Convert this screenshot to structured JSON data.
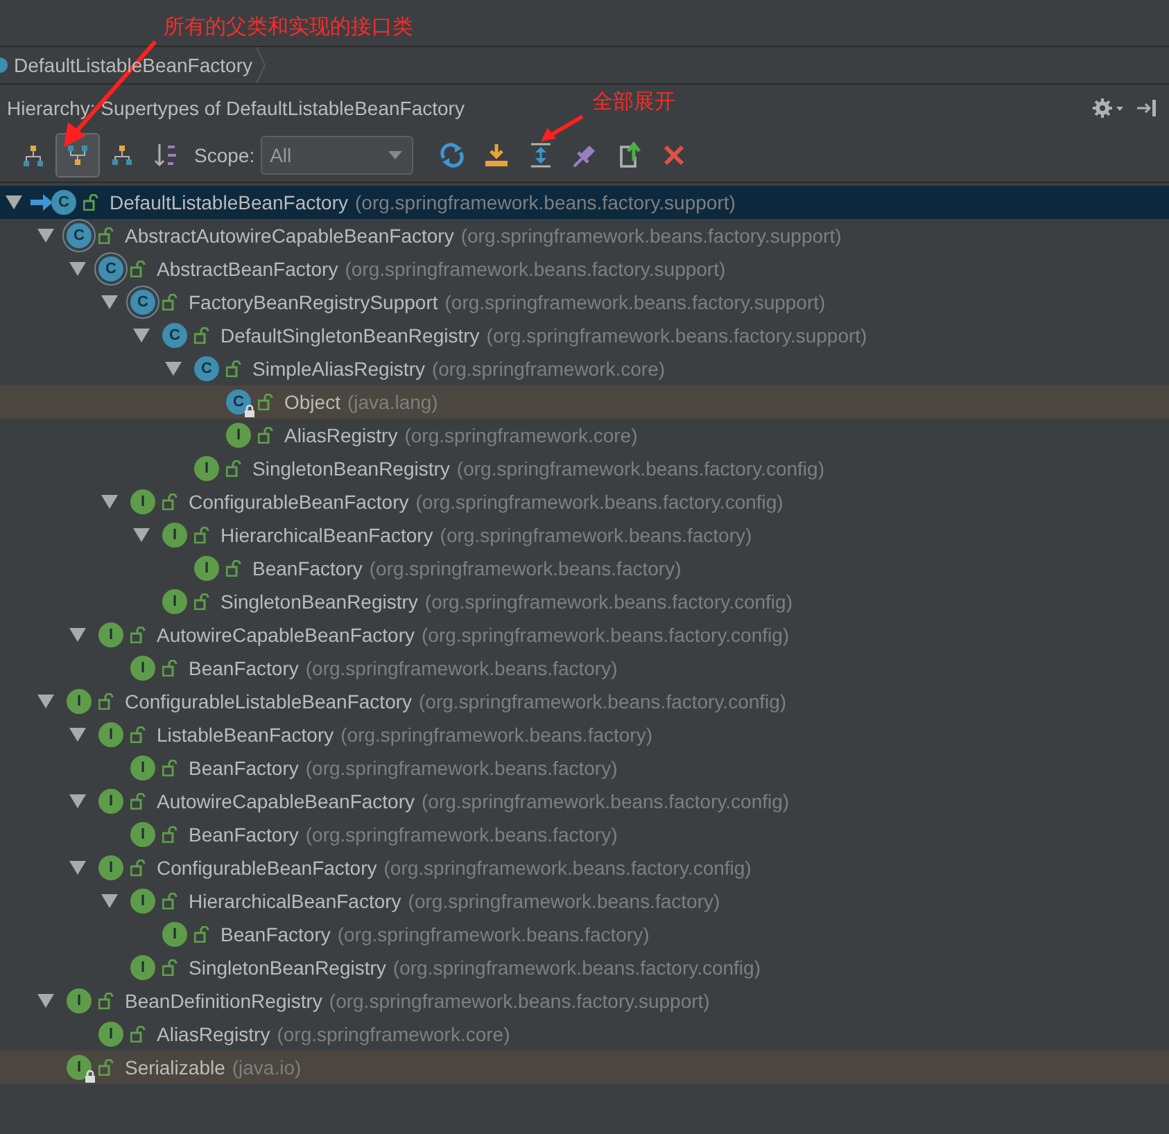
{
  "annotations": [
    {
      "text": "所有的父类和实现的接口类"
    },
    {
      "text": "全部展开"
    }
  ],
  "breadcrumb": {
    "label": "DefaultListableBeanFactory"
  },
  "header": {
    "title": "Hierarchy: Supertypes of DefaultListableBeanFactory"
  },
  "toolbar": {
    "view_buttons": [
      {
        "kind": "class_hierarchy",
        "selected": false
      },
      {
        "kind": "supertypes",
        "selected": true
      },
      {
        "kind": "subtypes",
        "selected": false
      }
    ],
    "scope_label": "Scope:",
    "scope_value": "All"
  },
  "tree": [
    {
      "name": "DefaultListableBeanFactory",
      "package": "(org.springframework.beans.factory.support)",
      "badge": "C",
      "kind": "current",
      "selected": true,
      "library": false,
      "children": [
        {
          "name": "AbstractAutowireCapableBeanFactory",
          "package": "(org.springframework.beans.factory.support)",
          "badge": "C",
          "kind": "abstract",
          "selected": false,
          "library": false,
          "children": [
            {
              "name": "AbstractBeanFactory",
              "package": "(org.springframework.beans.factory.support)",
              "badge": "C",
              "kind": "abstract",
              "selected": false,
              "library": false,
              "children": [
                {
                  "name": "FactoryBeanRegistrySupport",
                  "package": "(org.springframework.beans.factory.support)",
                  "badge": "C",
                  "kind": "abstract",
                  "selected": false,
                  "library": false,
                  "children": [
                    {
                      "name": "DefaultSingletonBeanRegistry",
                      "package": "(org.springframework.beans.factory.support)",
                      "badge": "C",
                      "kind": "class",
                      "selected": false,
                      "library": false,
                      "children": [
                        {
                          "name": "SimpleAliasRegistry",
                          "package": "(org.springframework.core)",
                          "badge": "C",
                          "kind": "class",
                          "selected": false,
                          "library": false,
                          "children": [
                            {
                              "name": "Object",
                              "package": "(java.lang)",
                              "badge": "C",
                              "kind": "class",
                              "selected": false,
                              "library": true
                            },
                            {
                              "name": "AliasRegistry",
                              "package": "(org.springframework.core)",
                              "badge": "I",
                              "kind": "interface",
                              "selected": false,
                              "library": false
                            }
                          ]
                        },
                        {
                          "name": "SingletonBeanRegistry",
                          "package": "(org.springframework.beans.factory.config)",
                          "badge": "I",
                          "kind": "interface",
                          "selected": false,
                          "library": false
                        }
                      ]
                    }
                  ]
                },
                {
                  "name": "ConfigurableBeanFactory",
                  "package": "(org.springframework.beans.factory.config)",
                  "badge": "I",
                  "kind": "interface",
                  "selected": false,
                  "library": false,
                  "children": [
                    {
                      "name": "HierarchicalBeanFactory",
                      "package": "(org.springframework.beans.factory)",
                      "badge": "I",
                      "kind": "interface",
                      "selected": false,
                      "library": false,
                      "children": [
                        {
                          "name": "BeanFactory",
                          "package": "(org.springframework.beans.factory)",
                          "badge": "I",
                          "kind": "interface",
                          "selected": false,
                          "library": false
                        }
                      ]
                    },
                    {
                      "name": "SingletonBeanRegistry",
                      "package": "(org.springframework.beans.factory.config)",
                      "badge": "I",
                      "kind": "interface",
                      "selected": false,
                      "library": false
                    }
                  ]
                }
              ]
            },
            {
              "name": "AutowireCapableBeanFactory",
              "package": "(org.springframework.beans.factory.config)",
              "badge": "I",
              "kind": "interface",
              "selected": false,
              "library": false,
              "children": [
                {
                  "name": "BeanFactory",
                  "package": "(org.springframework.beans.factory)",
                  "badge": "I",
                  "kind": "interface",
                  "selected": false,
                  "library": false
                }
              ]
            }
          ]
        },
        {
          "name": "ConfigurableListableBeanFactory",
          "package": "(org.springframework.beans.factory.config)",
          "badge": "I",
          "kind": "interface",
          "selected": false,
          "library": false,
          "children": [
            {
              "name": "ListableBeanFactory",
              "package": "(org.springframework.beans.factory)",
              "badge": "I",
              "kind": "interface",
              "selected": false,
              "library": false,
              "children": [
                {
                  "name": "BeanFactory",
                  "package": "(org.springframework.beans.factory)",
                  "badge": "I",
                  "kind": "interface",
                  "selected": false,
                  "library": false
                }
              ]
            },
            {
              "name": "AutowireCapableBeanFactory",
              "package": "(org.springframework.beans.factory.config)",
              "badge": "I",
              "kind": "interface",
              "selected": false,
              "library": false,
              "children": [
                {
                  "name": "BeanFactory",
                  "package": "(org.springframework.beans.factory)",
                  "badge": "I",
                  "kind": "interface",
                  "selected": false,
                  "library": false
                }
              ]
            },
            {
              "name": "ConfigurableBeanFactory",
              "package": "(org.springframework.beans.factory.config)",
              "badge": "I",
              "kind": "interface",
              "selected": false,
              "library": false,
              "children": [
                {
                  "name": "HierarchicalBeanFactory",
                  "package": "(org.springframework.beans.factory)",
                  "badge": "I",
                  "kind": "interface",
                  "selected": false,
                  "library": false,
                  "children": [
                    {
                      "name": "BeanFactory",
                      "package": "(org.springframework.beans.factory)",
                      "badge": "I",
                      "kind": "interface",
                      "selected": false,
                      "library": false
                    }
                  ]
                },
                {
                  "name": "SingletonBeanRegistry",
                  "package": "(org.springframework.beans.factory.config)",
                  "badge": "I",
                  "kind": "interface",
                  "selected": false,
                  "library": false
                }
              ]
            }
          ]
        },
        {
          "name": "BeanDefinitionRegistry",
          "package": "(org.springframework.beans.factory.support)",
          "badge": "I",
          "kind": "interface",
          "selected": false,
          "library": false,
          "children": [
            {
              "name": "AliasRegistry",
              "package": "(org.springframework.core)",
              "badge": "I",
              "kind": "interface",
              "selected": false,
              "library": false
            }
          ]
        },
        {
          "name": "Serializable",
          "package": "(java.io)",
          "badge": "I",
          "kind": "interface",
          "selected": false,
          "library": true
        }
      ]
    }
  ]
}
